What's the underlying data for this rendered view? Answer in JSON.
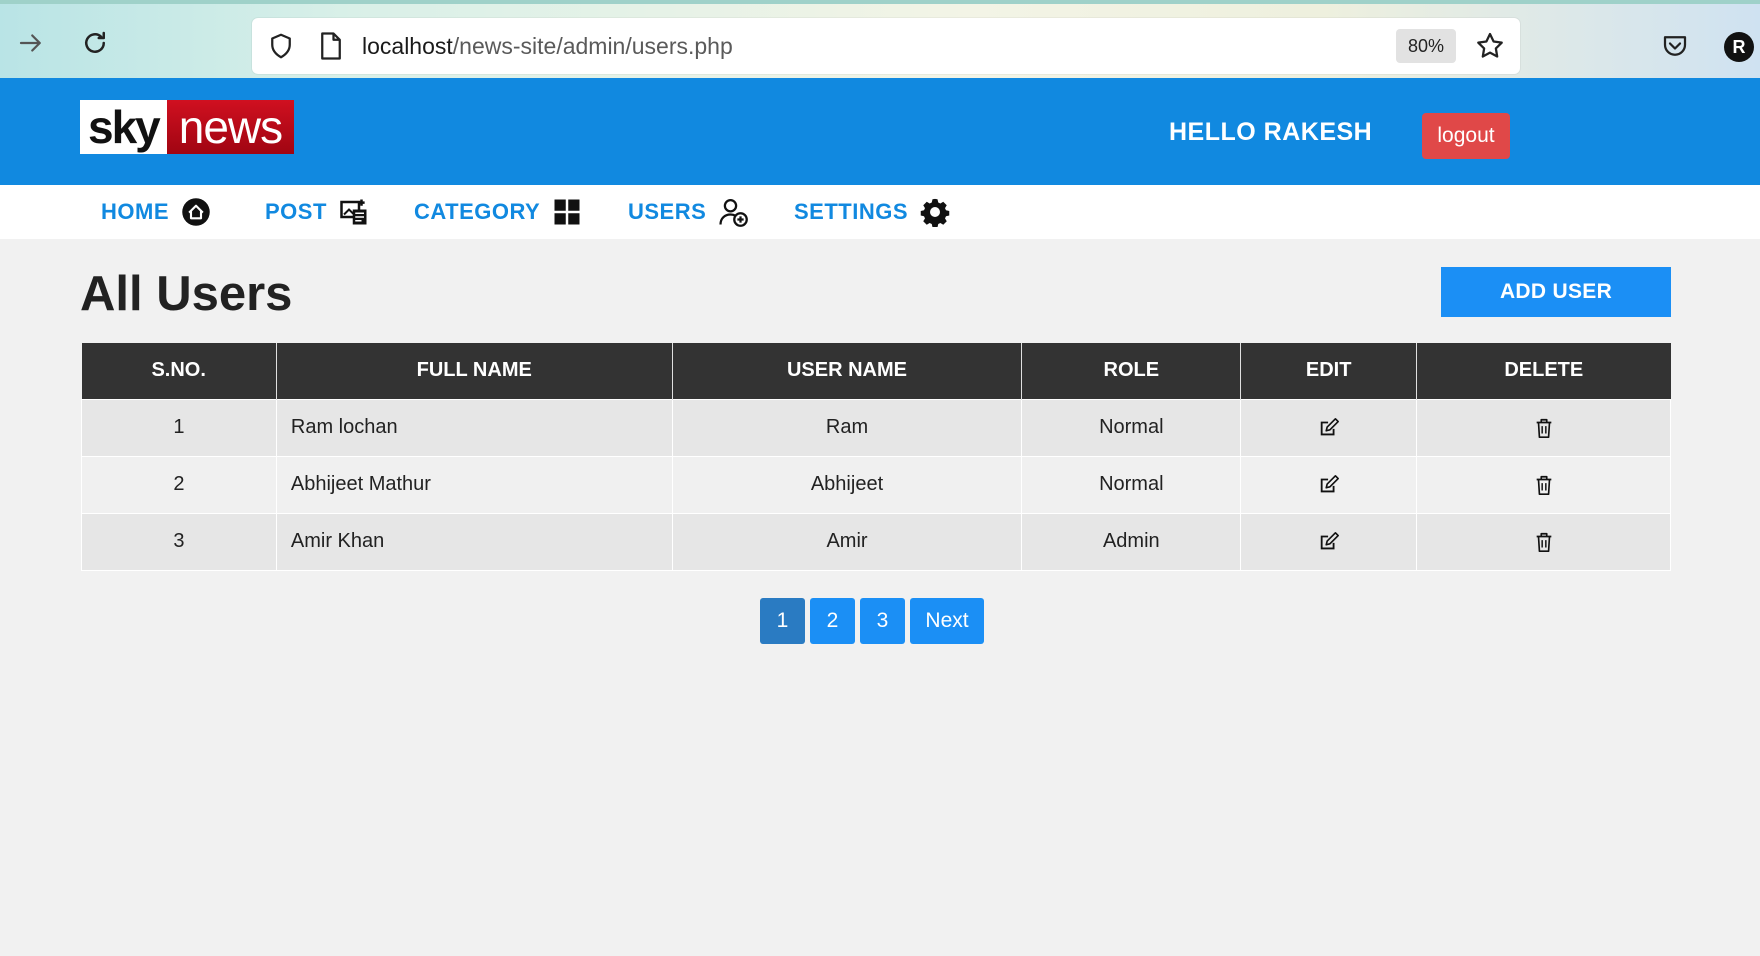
{
  "browser": {
    "url_host": "localhost",
    "url_path": "/news-site/admin/users.php",
    "zoom": "80%",
    "profile_initial": "R"
  },
  "header": {
    "logo_sky": "sky",
    "logo_news": "news",
    "greeting": "HELLO RAKESH",
    "logout_label": "logout"
  },
  "menu": {
    "items": [
      {
        "label": "HOME",
        "icon": "home-icon"
      },
      {
        "label": "POST",
        "icon": "image-post-icon"
      },
      {
        "label": "CATEGORY",
        "icon": "grid-icon"
      },
      {
        "label": "USERS",
        "icon": "add-user-icon"
      },
      {
        "label": "SETTINGS",
        "icon": "gear-icon"
      }
    ]
  },
  "main": {
    "title": "All Users",
    "add_user_label": "ADD USER",
    "table": {
      "headers": [
        "S.NO.",
        "FULL NAME",
        "USER NAME",
        "ROLE",
        "EDIT",
        "DELETE"
      ],
      "rows": [
        {
          "sno": "1",
          "full_name": "Ram lochan",
          "user_name": "Ram",
          "role": "Normal"
        },
        {
          "sno": "2",
          "full_name": "Abhijeet Mathur",
          "user_name": "Abhijeet",
          "role": "Normal"
        },
        {
          "sno": "3",
          "full_name": "Amir Khan",
          "user_name": "Amir",
          "role": "Admin"
        }
      ]
    },
    "pagination": {
      "pages": [
        "1",
        "2",
        "3"
      ],
      "active": "1",
      "next_label": "Next"
    }
  },
  "colors": {
    "header_blue": "#1189e0",
    "button_blue": "#1b8ff5",
    "logout_red": "#e04848",
    "table_header": "#333333"
  }
}
